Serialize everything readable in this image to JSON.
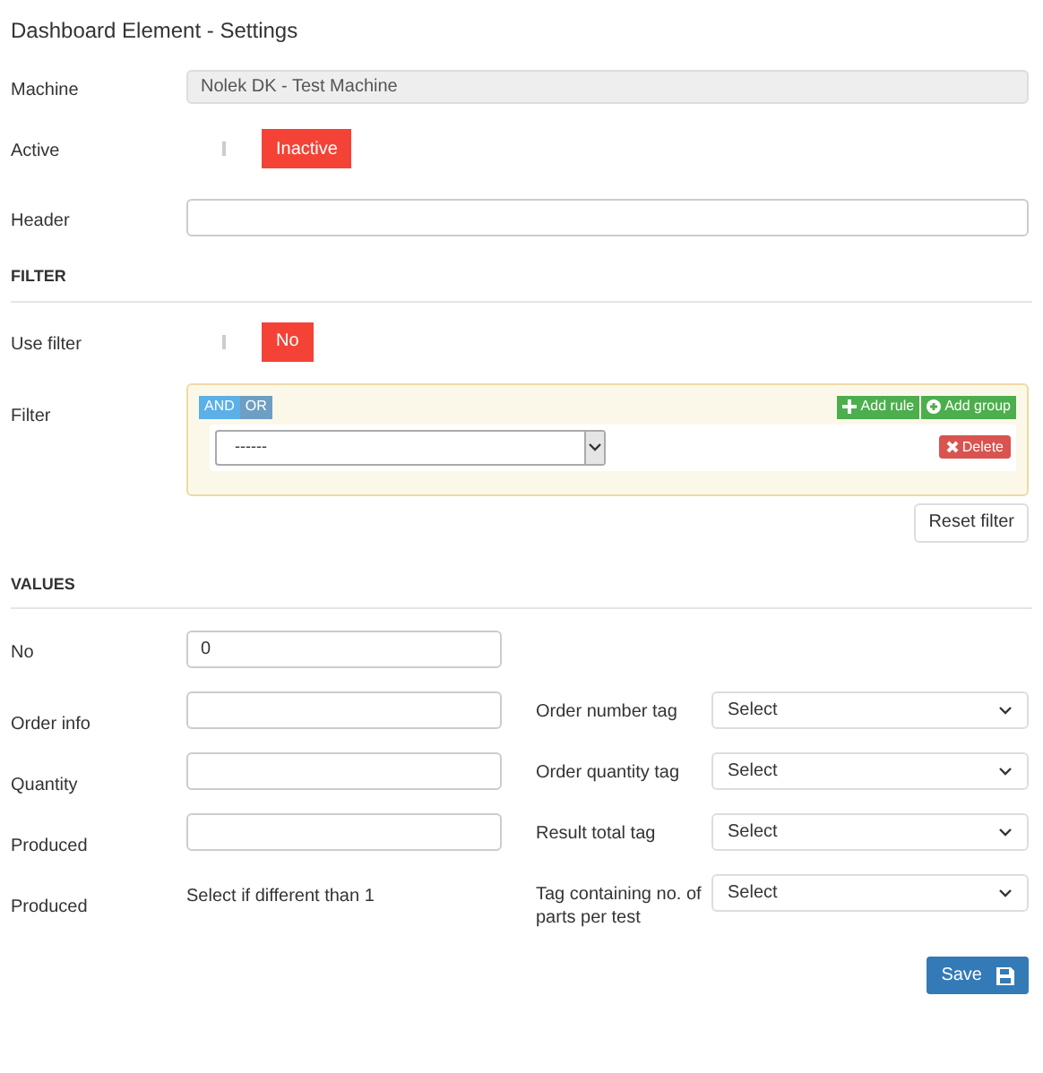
{
  "title": "Dashboard Element - Settings",
  "machine": {
    "label": "Machine",
    "value": "Nolek DK - Test Machine",
    "disabled": true
  },
  "active": {
    "label": "Active",
    "on": false,
    "text": "Inactive"
  },
  "header": {
    "label": "Header"
  },
  "filter_section": {
    "title": "FILTER",
    "use_filter": {
      "label": "Use filter",
      "on": false,
      "text": "No"
    },
    "filter": {
      "label": "Filter",
      "conditions": [
        {
          "label": "AND",
          "selected": true
        },
        {
          "label": "OR",
          "selected": false
        }
      ],
      "add_rule": "Add rule",
      "add_group": "Add group",
      "rule": {
        "value": "------",
        "delete": "Delete"
      }
    },
    "reset": "Reset filter"
  },
  "values_section": {
    "title": "VALUES",
    "no": {
      "label": "No",
      "value": "0"
    },
    "rows": [
      {
        "left": {
          "label": "Order info",
          "kind": "input"
        },
        "right": {
          "label": "Order number tag",
          "value": "Select"
        }
      },
      {
        "left": {
          "label": "Quantity",
          "kind": "input"
        },
        "right": {
          "label": "Order quantity tag",
          "value": "Select"
        }
      },
      {
        "left": {
          "label": "Produced",
          "kind": "input"
        },
        "right": {
          "label": "Result total tag",
          "value": "Select"
        }
      },
      {
        "left": {
          "label": "Produced",
          "kind": "text",
          "text": "Select if different than 1"
        },
        "right": {
          "label": "Tag containing no. of parts per test",
          "value": "Select"
        }
      }
    ]
  },
  "save": "Save"
}
